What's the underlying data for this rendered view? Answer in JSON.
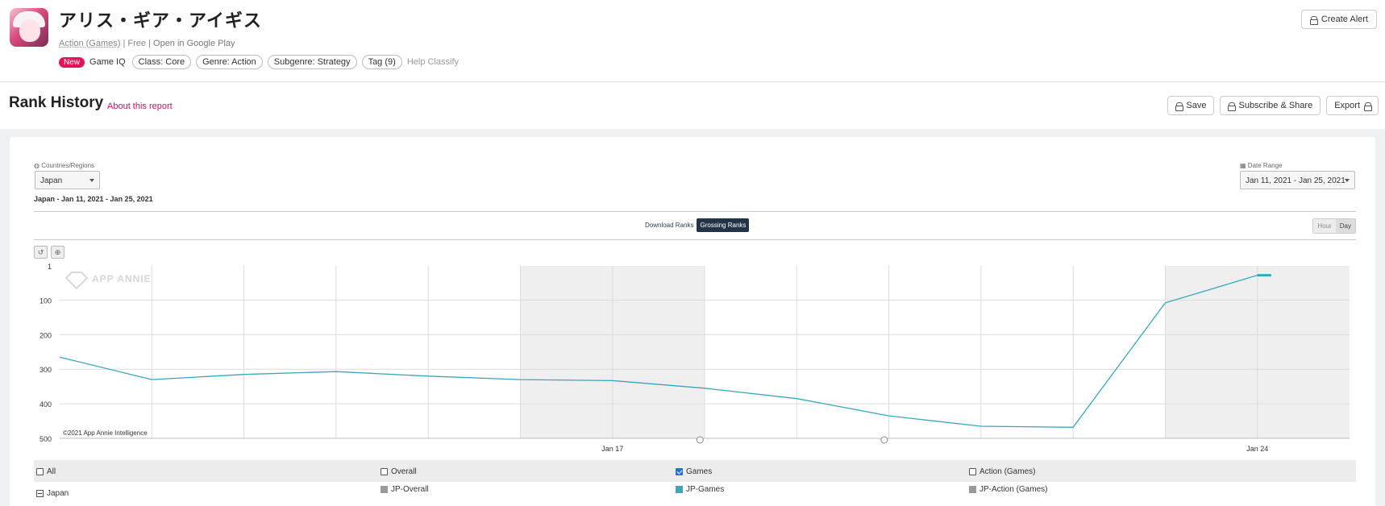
{
  "app": {
    "title": "アリス・ギア・アイギス",
    "category": "Action (Games)",
    "separator1": " | ",
    "price": "Free",
    "separator2": " | ",
    "store_link": "Open in Google Play",
    "new_badge": "New",
    "game_iq": "Game IQ",
    "tags": [
      "Class: Core",
      "Genre: Action",
      "Subgenre: Strategy",
      "Tag (9)"
    ],
    "help_classify": "Help Classify",
    "create_alert": "Create Alert"
  },
  "section": {
    "title": "Rank History",
    "about": "About this report",
    "buttons": {
      "save": "Save",
      "subscribe": "Subscribe & Share",
      "export": "Export"
    }
  },
  "controls": {
    "countries_label": "Countries/Regions",
    "country_value": "Japan",
    "date_label": "Date Range",
    "date_value": "Jan 11, 2021 - Jan 25, 2021",
    "subtitle": "Japan - Jan 11, 2021 - Jan 25, 2021",
    "rank_tabs": [
      "Download Ranks",
      "Grossing Ranks"
    ],
    "active_rank_tab": "Grossing Ranks",
    "granularity": [
      "Hour",
      "Day"
    ],
    "active_granularity": "Day"
  },
  "chart_data": {
    "type": "line",
    "watermark": "APP ANNIE",
    "copyright": "©2021 App Annie Intelligence",
    "y_reversed": true,
    "ylim": [
      1,
      500
    ],
    "y_ticks": [
      "1",
      "100",
      "200",
      "300",
      "400",
      "500"
    ],
    "x_tick_labels": [
      {
        "label": "Jan 17",
        "day": 17
      },
      {
        "label": "Jan 24",
        "day": 24
      }
    ],
    "weekend_shading": [
      [
        16,
        18
      ],
      [
        23,
        25
      ]
    ],
    "color": "#3aa6b9",
    "series": [
      {
        "name": "JP-Games",
        "x": [
          11,
          12,
          13,
          14,
          15,
          16,
          17,
          18,
          19,
          20,
          21,
          22,
          23,
          24,
          24.15
        ],
        "values": [
          265,
          330,
          315,
          307,
          320,
          330,
          333,
          355,
          385,
          435,
          465,
          468,
          108,
          28,
          28
        ]
      }
    ]
  },
  "legend": {
    "headers": [
      "All",
      "Overall",
      "Games",
      "Action (Games)"
    ],
    "checked": [
      false,
      false,
      true,
      false
    ],
    "row_country": "Japan",
    "row_items": [
      {
        "label": "JP-Overall",
        "color": "#9a9a9a"
      },
      {
        "label": "JP-Games",
        "color": "#3aa6b9"
      },
      {
        "label": "JP-Action (Games)",
        "color": "#9a9a9a"
      }
    ]
  }
}
